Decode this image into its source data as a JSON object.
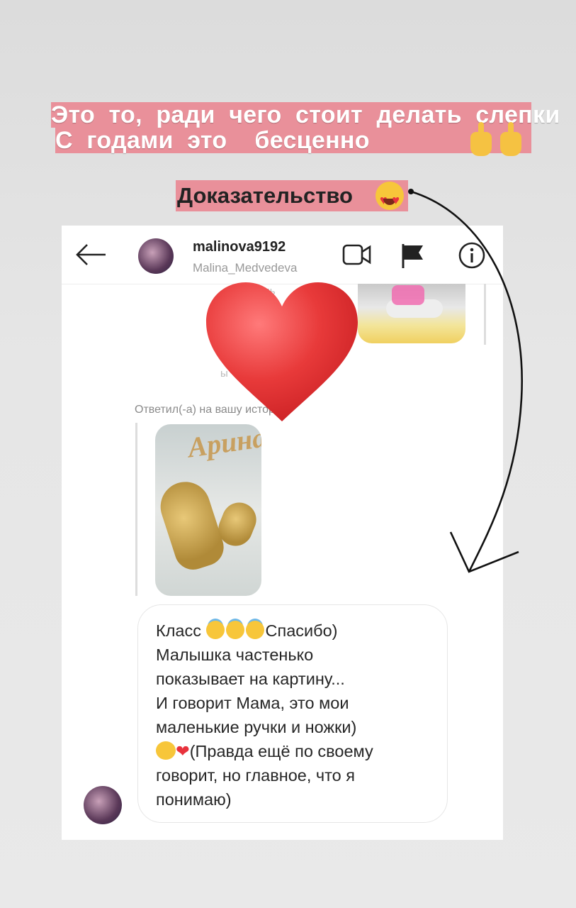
{
  "captions": {
    "line1": "Это  то,  ради  чего  стоит  делать  слепки",
    "line2": "С  годами  это    бесценно",
    "proof": "Доказательство"
  },
  "icons": [
    "pointing-up-icon",
    "heart-eyes-icon",
    "back-arrow-icon",
    "video-call-icon",
    "flag-icon",
    "info-icon",
    "smiling-halo-icon",
    "hugging-face-icon",
    "heart-icon"
  ],
  "colors": {
    "caption_bg": "#e9909a",
    "heart": "#e8323c"
  },
  "chat": {
    "username": "malinova9192",
    "fullname": "Malina_Medvedeva",
    "replied_label": "Ответил(-а) на вашу историю",
    "story_name": "Арина",
    "message": {
      "line1_prefix": "Класс ",
      "line1_suffix": "Спасибо)",
      "line2": "Малышка частенько",
      "line3": "показывает на картину...",
      "line4": "И говорит Мама, это мои",
      "line5": "маленькие ручки и ножки)",
      "line6_suffix": "(Правда ещё по своему",
      "line7": "говорит, но главное, что я",
      "line8": "понимаю)"
    }
  }
}
